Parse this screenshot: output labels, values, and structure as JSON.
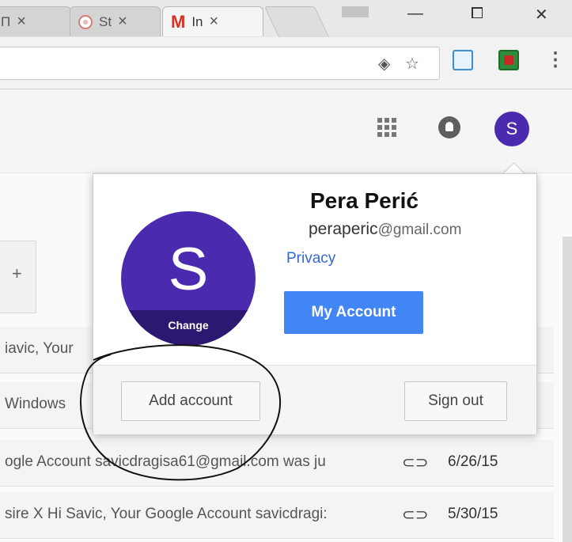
{
  "browser": {
    "tabs": [
      {
        "label": "П",
        "close": "×"
      },
      {
        "label": "St",
        "close": "×"
      },
      {
        "label": "In",
        "close": "×",
        "active": true,
        "icon": "M"
      }
    ],
    "window_controls": {
      "minimize": "—",
      "maximize": "⧠",
      "close": "✕"
    },
    "toolbar_icons": [
      "eye-icon",
      "star-icon"
    ],
    "menu": "⋮"
  },
  "gmail_header": {
    "avatar_letter": "S"
  },
  "popup": {
    "avatar_letter": "S",
    "change_label": "Change",
    "name": "Pera Perić",
    "email_user": "peraperic",
    "email_domain": "@gmail.com",
    "privacy": "Privacy",
    "my_account": "My Account",
    "add_account": "Add account",
    "sign_out": "Sign out"
  },
  "tab_add": "+",
  "mail_rows": [
    {
      "snippet": "iavic, Your",
      "date": ""
    },
    {
      "snippet": "Windows",
      "date": ""
    },
    {
      "snippet": "ogle Account savicdragisa61@gmail.com was ju",
      "date": "6/26/15"
    },
    {
      "snippet": "sire X Hi Savic, Your Google Account savicdragi:",
      "date": "5/30/15"
    }
  ],
  "colors": {
    "avatar": "#4a2bb0",
    "primary_button": "#4285f4",
    "link": "#3367d6"
  }
}
